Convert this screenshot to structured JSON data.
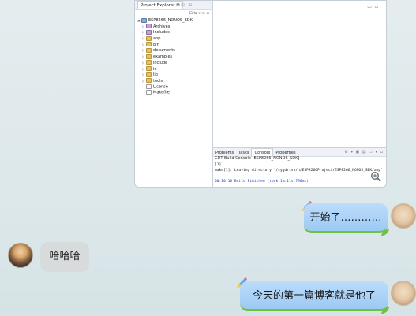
{
  "screenshot": {
    "project_explorer": {
      "tab_label": "Project Explorer",
      "project_name": "ESP8266_NONOS_SDK",
      "items": [
        {
          "label": "Archives",
          "kind": "lib"
        },
        {
          "label": "Includes",
          "kind": "lib"
        },
        {
          "label": "app",
          "kind": "folder"
        },
        {
          "label": "bin",
          "kind": "folder"
        },
        {
          "label": "documents",
          "kind": "folder"
        },
        {
          "label": "examples",
          "kind": "folder"
        },
        {
          "label": "include",
          "kind": "folder"
        },
        {
          "label": "ld",
          "kind": "folder"
        },
        {
          "label": "lib",
          "kind": "folder"
        },
        {
          "label": "tools",
          "kind": "folder"
        },
        {
          "label": "License",
          "kind": "file"
        },
        {
          "label": "Makefile",
          "kind": "file"
        }
      ]
    },
    "console": {
      "tabs": [
        "Problems",
        "Tasks",
        "Console",
        "Properties"
      ],
      "active_tab": "Console",
      "title": "CDT Build Console [ESP8266_NONOS_SDK]",
      "lines": [
        {
          "text": "[1]",
          "color": "#222222"
        },
        {
          "text": "make[1]: Leaving directory '/cygdrive/h/ESP8266Project/ESP8266_NONOS_SDK/app'",
          "color": "#222222"
        },
        {
          "text": "",
          "color": "#222222"
        },
        {
          "text": "00:10:10 Build Finished (took 1m:11s.790ms)",
          "color": "#2a3cc8"
        }
      ]
    }
  },
  "chat": {
    "messages": [
      {
        "sender": "me",
        "text": "开始了…………"
      },
      {
        "sender": "other",
        "text": "哈哈哈"
      },
      {
        "sender": "me",
        "text": "今天的第一篇博客就是他了"
      }
    ]
  },
  "colors": {
    "my_bubble": "#a8d2f7",
    "my_bubble_accent": "#6fc23f",
    "other_bubble": "#d8dbdc",
    "background": "#dde8ea"
  }
}
